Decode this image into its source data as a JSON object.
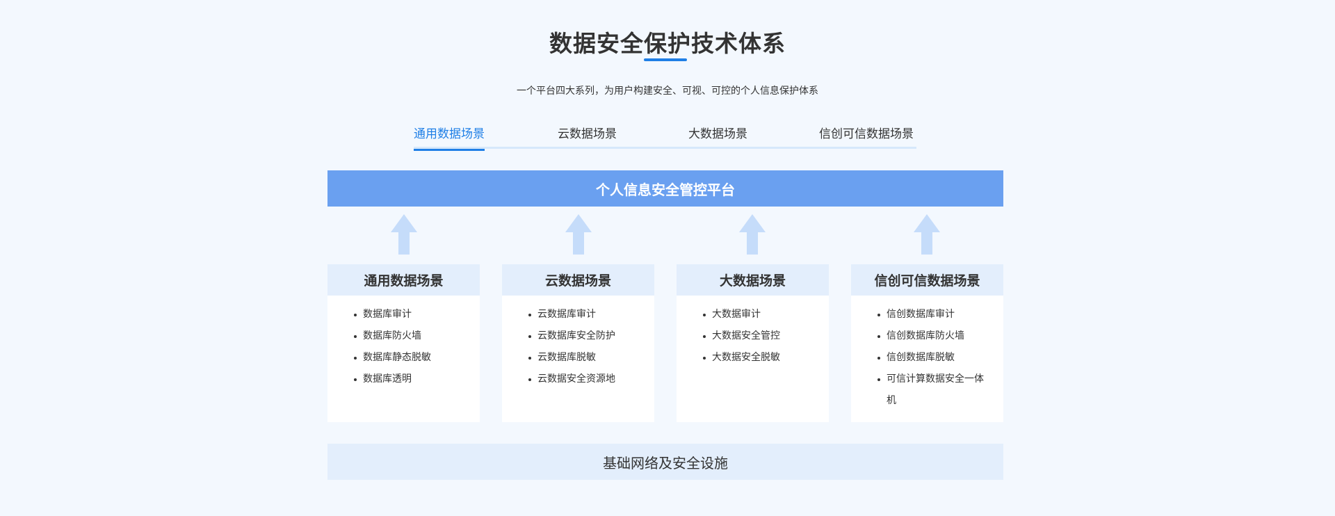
{
  "header": {
    "title": "数据安全保护技术体系",
    "subtitle": "一个平台四大系列，为用户构建安全、可视、可控的个人信息保护体系"
  },
  "tabs": [
    {
      "label": "通用数据场景",
      "active": true
    },
    {
      "label": "云数据场景",
      "active": false
    },
    {
      "label": "大数据场景",
      "active": false
    },
    {
      "label": "信创可信数据场景",
      "active": false
    }
  ],
  "platform": {
    "label": "个人信息安全管控平台"
  },
  "arrow_icon": "arrow-up-icon",
  "cards": [
    {
      "title": "通用数据场景",
      "items": [
        "数据库审计",
        "数据库防火墙",
        "数据库静态脱敏",
        "数据库透明"
      ]
    },
    {
      "title": "云数据场景",
      "items": [
        "云数据库审计",
        "云数据库安全防护",
        "云数据库脱敏",
        "云数据安全资源地"
      ]
    },
    {
      "title": "大数据场景",
      "items": [
        "大数据审计",
        "大数据安全管控",
        "大数据安全脱敏"
      ]
    },
    {
      "title": "信创可信数据场景",
      "items": [
        "信创数据库审计",
        "信创数据库防火墙",
        "信创数据库脱敏",
        "可信计算数据安全一体机"
      ]
    }
  ],
  "infrastructure": {
    "label": "基础网络及安全设施"
  },
  "colors": {
    "accent": "#1f7fe6",
    "platform_bar": "#6aa0f0",
    "card_header": "#e3eefc",
    "arrow": "#c5dcfa",
    "background": "#f3f8fe"
  }
}
